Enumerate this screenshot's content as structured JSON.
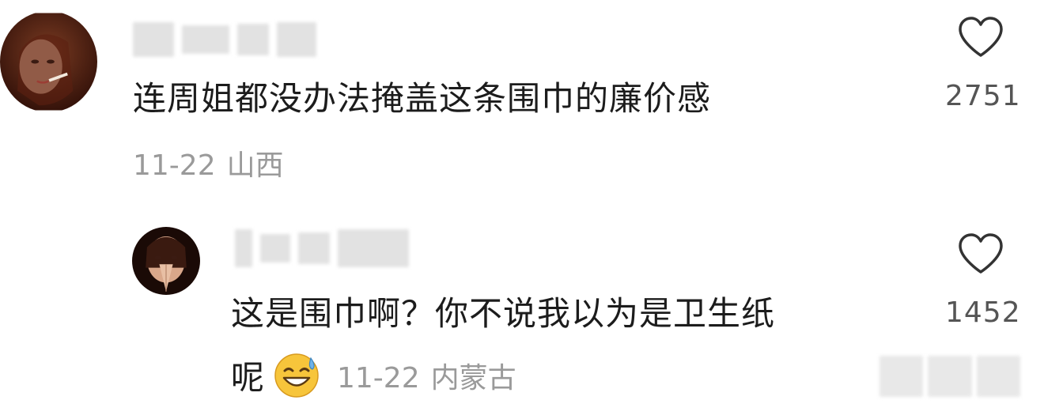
{
  "comments": [
    {
      "text": "连周姐都没办法掩盖这条围巾的廉价感",
      "date": "11-22",
      "region": "山西",
      "likes": "2751",
      "avatar_icon": "woman-smoking-avatar",
      "username_blurred": true
    },
    {
      "text_line1": "这是围巾啊？你不说我以为是卫生纸",
      "text_line2": "呢",
      "emoji_icon": "sweat-smile-emoji",
      "date": "11-22",
      "region": "内蒙古",
      "likes": "1452",
      "avatar_icon": "woman-hands-face-avatar",
      "username_blurred": true
    }
  ],
  "colors": {
    "text": "#1c1c1c",
    "meta": "#9a9a9a",
    "count": "#555555",
    "heart_stroke": "#333333"
  }
}
